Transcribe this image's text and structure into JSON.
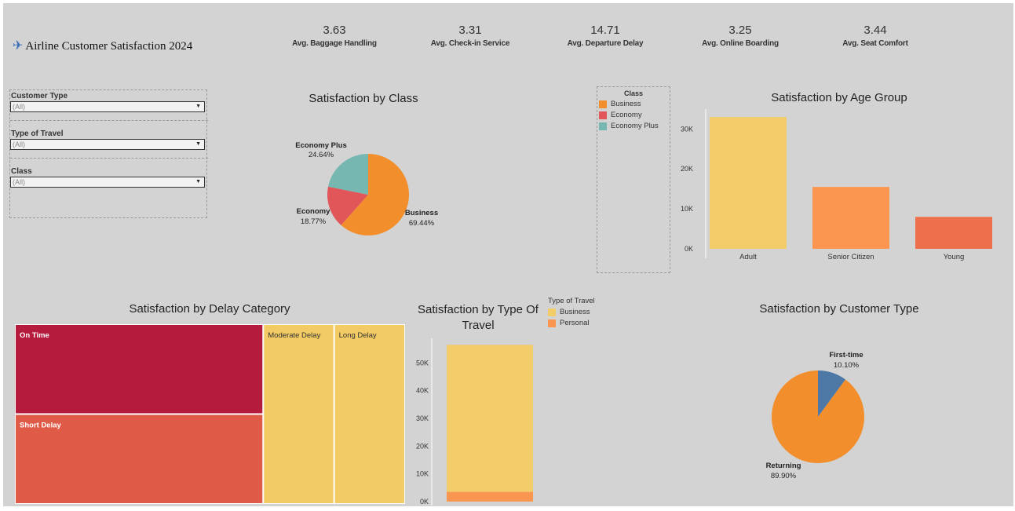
{
  "header": {
    "title": "Airline Customer Satisfaction  2024",
    "icon": "airplane-icon"
  },
  "kpis": [
    {
      "value": "3.63",
      "label": "Avg. Baggage Handling"
    },
    {
      "value": "3.31",
      "label": "Avg. Check-in Service"
    },
    {
      "value": "14.71",
      "label": "Avg. Departure Delay"
    },
    {
      "value": "3.25",
      "label": "Avg. Online Boarding"
    },
    {
      "value": "3.44",
      "label": "Avg. Seat Comfort"
    }
  ],
  "filters": [
    {
      "label": "Customer Type",
      "value": "(All)"
    },
    {
      "label": "Type of Travel",
      "value": "(All)"
    },
    {
      "label": "Class",
      "value": "(All)"
    }
  ],
  "class_legend": {
    "title": "Class",
    "items": [
      "Business",
      "Economy",
      "Economy Plus"
    ]
  },
  "travel_legend": {
    "title": "Type of Travel",
    "items": [
      "Business",
      "Personal"
    ]
  },
  "colors": {
    "background": "#d3d3d3",
    "business": "#f28e2b",
    "economy": "#e15759",
    "economy_plus": "#76b7b2",
    "adult": "#f2cd6a",
    "senior": "#fb9650",
    "young": "#ed6f4b",
    "on_time": "#b51b3c",
    "short_delay": "#e05a48",
    "moderate_delay": "#f2cb65",
    "long_delay": "#f2cb65",
    "first_time": "#4e79a7",
    "returning": "#f28e2b"
  },
  "chart_data": [
    {
      "type": "pie",
      "title": "Satisfaction by Class",
      "labels": [
        "Business",
        "Economy",
        "Economy Plus"
      ],
      "values": [
        69.44,
        18.77,
        24.64
      ],
      "value_labels": [
        "69.44%",
        "18.77%",
        "24.64%"
      ]
    },
    {
      "type": "bar",
      "title": "Satisfaction by Age Group",
      "categories": [
        "Adult",
        "Senior Citizen",
        "Young"
      ],
      "values": [
        33000,
        15500,
        8000
      ],
      "ylim": [
        0,
        34000
      ],
      "yticks": [
        0,
        10000,
        20000,
        30000
      ],
      "ytick_labels": [
        "0K",
        "10K",
        "20K",
        "30K"
      ]
    },
    {
      "type": "heatmap",
      "subtype": "treemap",
      "title": "Satisfaction by Delay Category",
      "labels": [
        "On Time",
        "Short Delay",
        "Moderate Delay",
        "Long Delay"
      ],
      "values": [
        21000,
        21000,
        12000,
        12000
      ]
    },
    {
      "type": "bar",
      "subtype": "stacked",
      "title": "Satisfaction by Type Of Travel",
      "series": [
        {
          "name": "Business",
          "values": [
            53000
          ]
        },
        {
          "name": "Personal",
          "values": [
            3500
          ]
        }
      ],
      "ylim": [
        0,
        58000
      ],
      "yticks": [
        0,
        10000,
        20000,
        30000,
        40000,
        50000
      ],
      "ytick_labels": [
        "0K",
        "10K",
        "20K",
        "30K",
        "40K",
        "50K"
      ]
    },
    {
      "type": "pie",
      "title": "Satisfaction by Customer Type",
      "labels": [
        "First-time",
        "Returning"
      ],
      "values": [
        10.1,
        89.9
      ],
      "value_labels": [
        "10.10%",
        "89.90%"
      ]
    }
  ]
}
